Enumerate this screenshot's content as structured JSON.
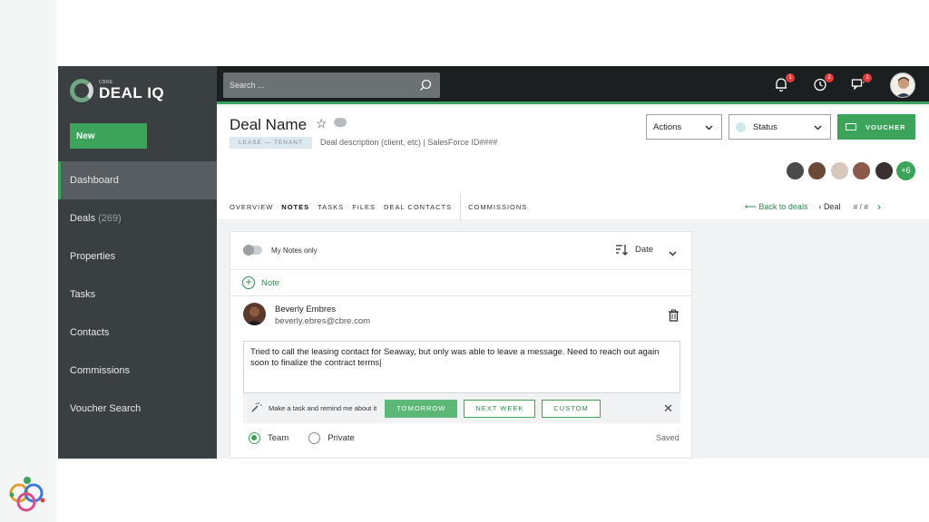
{
  "app": {
    "logo_small": "CBRE",
    "logo_big": "DEAL IQ"
  },
  "sidebar": {
    "new_label": "New",
    "items": [
      {
        "label": "Dashboard",
        "count": ""
      },
      {
        "label": "Deals",
        "count": "(269)"
      },
      {
        "label": "Properties",
        "count": ""
      },
      {
        "label": "Tasks",
        "count": ""
      },
      {
        "label": "Contacts",
        "count": ""
      },
      {
        "label": "Commissions",
        "count": ""
      },
      {
        "label": "Voucher Search",
        "count": ""
      }
    ]
  },
  "topbar": {
    "search_placeholder": "Search ...",
    "notifications_badge": "1",
    "history_badge": "2",
    "messages_badge": "1"
  },
  "header": {
    "title": "Deal Name",
    "tag": "LEASE — TENANT",
    "description": "Deal description (client, etc) | SalesForce ID####",
    "actions_label": "Actions",
    "status_label": "Status",
    "voucher_label": "VOUCHER",
    "team_more": "+6",
    "tabs": [
      "OVERVIEW",
      "NOTES",
      "TASKS",
      "FILES",
      "DEAL CONTACTS",
      "COMMISSIONS"
    ],
    "back_label": "Back to deals",
    "deal_nav_label": "Deal",
    "pager": "# / #"
  },
  "notes": {
    "my_notes_label": "My Notes only",
    "sort_label": "Date",
    "add_note_label": "Note",
    "author_name": "Beverly Embres",
    "author_email": "beverly.ebres@cbre.com",
    "note_text": "Tried to call the leasing contact for Seaway, but only was able to leave a message. Need to reach out again soon to finalize the contract terms|",
    "remind_label": "Make a task and remind me about it",
    "remind_tomorrow": "TOMORROW",
    "remind_next_week": "NEXT WEEK",
    "remind_custom": "CUSTOM",
    "visibility_team": "Team",
    "visibility_private": "Private",
    "saved_label": "Saved"
  },
  "colors": {
    "accent": "#3ba45a",
    "sidebar": "#3a3f41",
    "topbar": "#1c1f20"
  }
}
